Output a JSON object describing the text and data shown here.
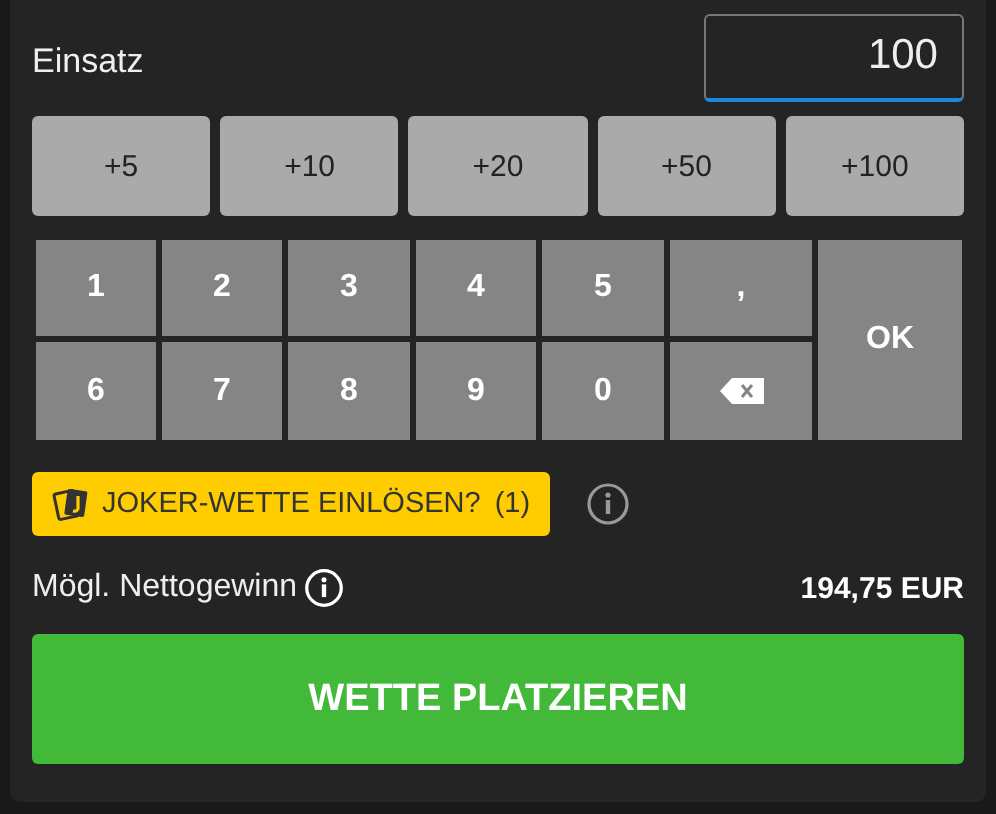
{
  "stake": {
    "label": "Einsatz",
    "value": "100"
  },
  "quick_amounts": [
    "+5",
    "+10",
    "+20",
    "+50",
    "+100"
  ],
  "keypad": [
    {
      "kind": "key",
      "label": "1"
    },
    {
      "kind": "key",
      "label": "2"
    },
    {
      "kind": "key",
      "label": "3"
    },
    {
      "kind": "key",
      "label": "4"
    },
    {
      "kind": "key",
      "label": "5"
    },
    {
      "kind": "key",
      "label": ","
    },
    {
      "kind": "ok",
      "label": "OK"
    },
    {
      "kind": "key",
      "label": "6"
    },
    {
      "kind": "key",
      "label": "7"
    },
    {
      "kind": "key",
      "label": "8"
    },
    {
      "kind": "key",
      "label": "9"
    },
    {
      "kind": "key",
      "label": "0"
    },
    {
      "kind": "backspace"
    }
  ],
  "joker": {
    "label": "JOKER-WETTE EINLÖSEN?",
    "count": "(1)"
  },
  "net_win": {
    "label": "Mögl. Nettogewinn",
    "amount": "194,75 EUR"
  },
  "place_bet": "WETTE PLATZIEREN"
}
